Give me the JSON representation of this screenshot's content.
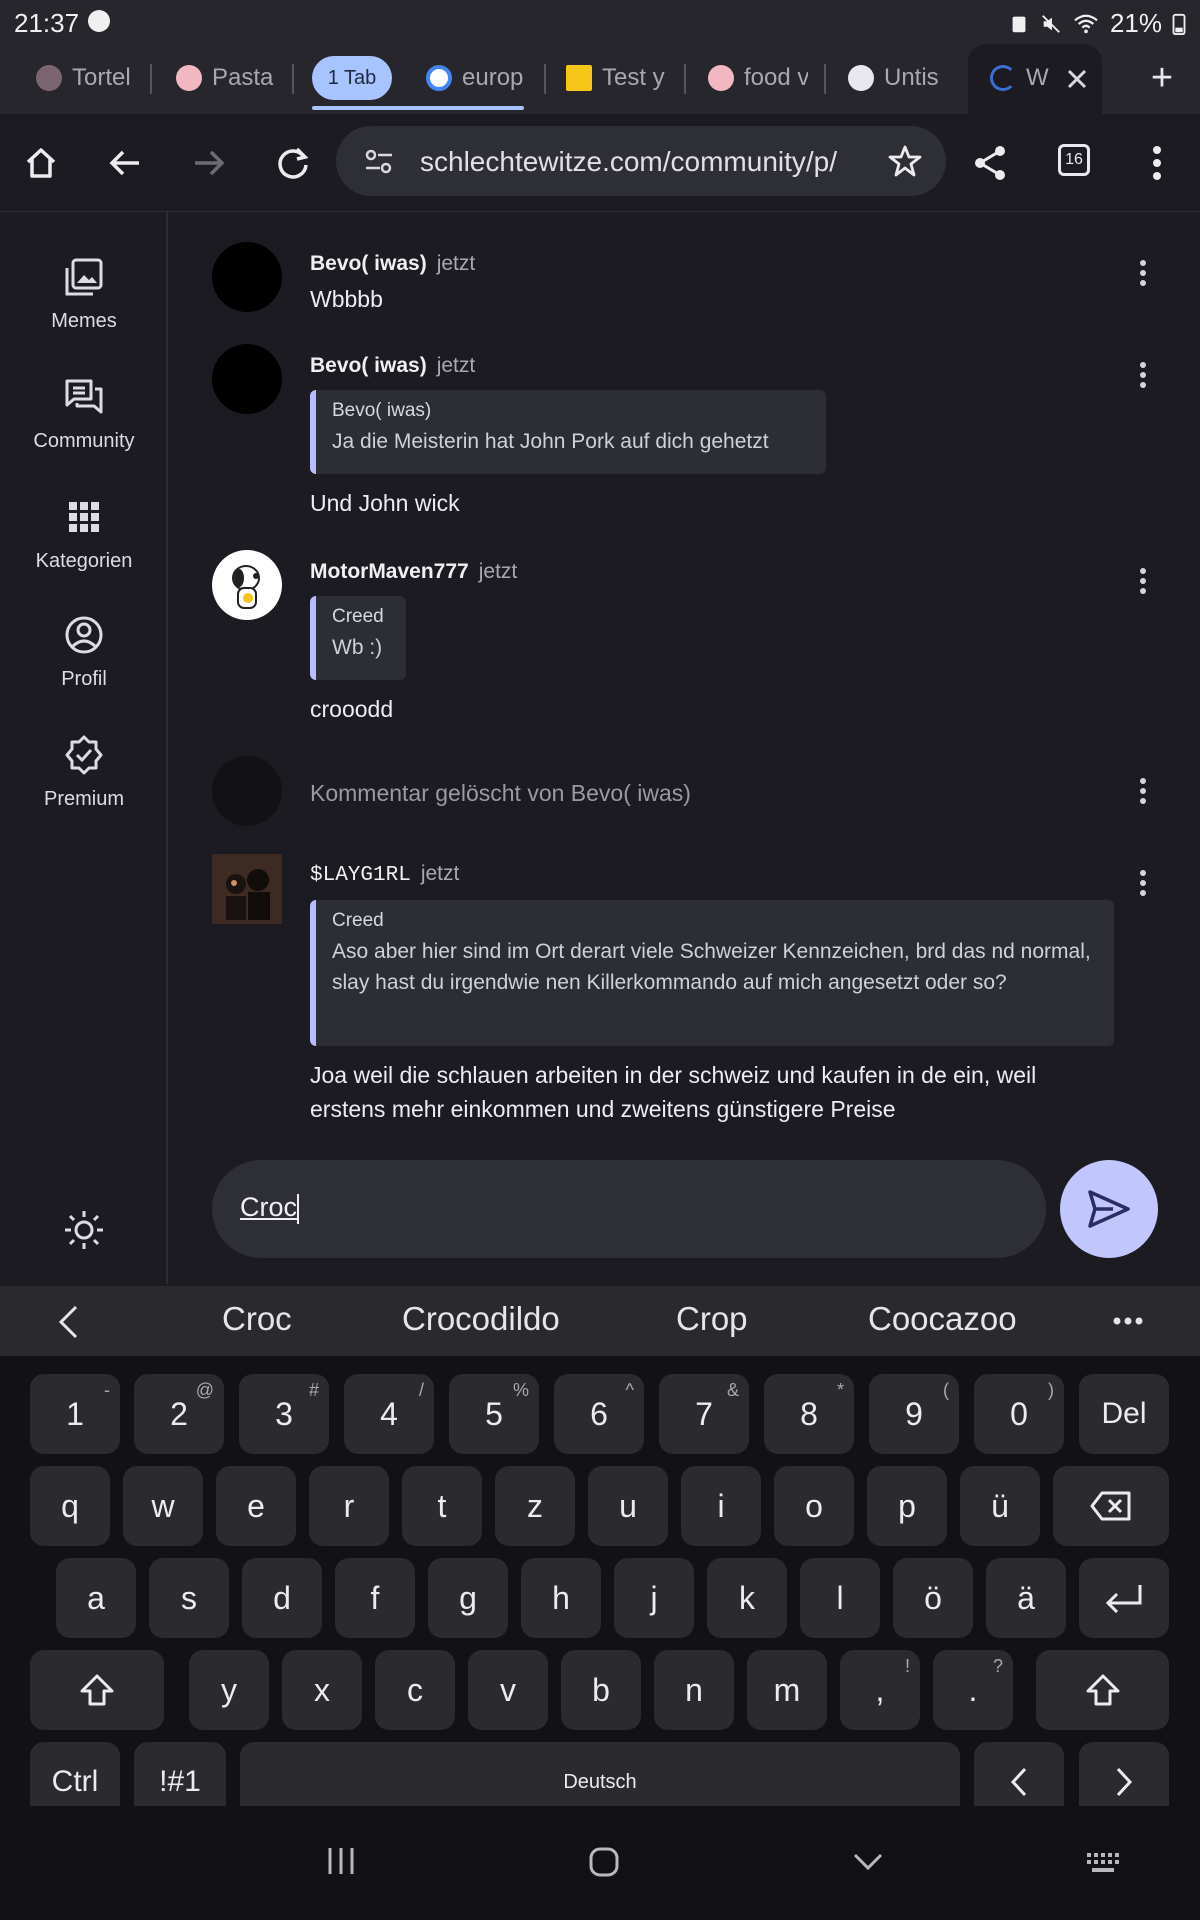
{
  "status": {
    "time": "21:37",
    "battery": "21%"
  },
  "tabs": [
    {
      "title": "Tortel",
      "fav_color": "#7b6670"
    },
    {
      "title": "Pasta",
      "fav_color": "#f2b8c2"
    },
    {
      "title": "europ",
      "fav_color": "#ffffff"
    },
    {
      "title": "Test y",
      "fav_color": "#f5c518"
    },
    {
      "title": "food v",
      "fav_color": "#f2b8c2"
    },
    {
      "title": "Untis",
      "fav_color": "#e8e8ee"
    },
    {
      "title": "Wi",
      "fav_color": "#3b6fd6"
    }
  ],
  "tab_group_label": "1 Tab",
  "new_tab_label": "+",
  "toolbar": {
    "url": "schlechtewitze.com/community/p/",
    "tab_count": "16"
  },
  "sidebar": {
    "items": [
      {
        "label": "Memes",
        "icon": "memes-icon"
      },
      {
        "label": "Community",
        "icon": "community-icon"
      },
      {
        "label": "Kategorien",
        "icon": "grid-icon"
      },
      {
        "label": "Profil",
        "icon": "profile-icon"
      },
      {
        "label": "Premium",
        "icon": "premium-badge-icon"
      }
    ]
  },
  "messages": [
    {
      "author": "Bevo( iwas)",
      "time": "jetzt",
      "text": "Wbbbb"
    },
    {
      "author": "Bevo( iwas)",
      "time": "jetzt",
      "quote_author": "Bevo( iwas)",
      "quote_text": "Ja die Meisterin hat John Pork auf dich gehetzt",
      "text": "Und John wick"
    },
    {
      "author": "MotorMaven777",
      "time": "jetzt",
      "quote_author": "Creed",
      "quote_text": "Wb :)",
      "text": "crooodd"
    },
    {
      "deleted_text": "Kommentar gelöscht von Bevo( iwas)"
    },
    {
      "author": "$LAYG1RL",
      "time": "jetzt",
      "quote_author": "Creed",
      "quote_text": "Aso aber hier sind im Ort derart viele Schweizer Kennzeichen, brd das nd normal, slay hast du irgendwie nen Killerkommando auf mich angesetzt oder so?",
      "text": "Joa weil die schlauen arbeiten in der schweiz und kaufen in de ein, weil erstens mehr einkommen und zweitens günstigere Preise"
    }
  ],
  "composer": {
    "value": "Croc"
  },
  "suggestions": [
    "Croc",
    "Crocodildo",
    "Crop",
    "Coocazoo"
  ],
  "keyboard": {
    "row1": [
      [
        "1",
        "-"
      ],
      [
        "2",
        "@"
      ],
      [
        "3",
        "#"
      ],
      [
        "4",
        "/"
      ],
      [
        "5",
        "%"
      ],
      [
        "6",
        "^"
      ],
      [
        "7",
        "&"
      ],
      [
        "8",
        "*"
      ],
      [
        "9",
        "("
      ],
      [
        "0",
        ")"
      ]
    ],
    "del": "Del",
    "row2": [
      "q",
      "w",
      "e",
      "r",
      "t",
      "z",
      "u",
      "i",
      "o",
      "p",
      "ü"
    ],
    "row3": [
      "a",
      "s",
      "d",
      "f",
      "g",
      "h",
      "j",
      "k",
      "l",
      "ö",
      "ä"
    ],
    "row4": [
      "y",
      "x",
      "c",
      "v",
      "b",
      "n",
      "m"
    ],
    "comma": [
      ",",
      "!"
    ],
    "period": [
      ".",
      "?"
    ],
    "ctrl": "Ctrl",
    "symbols": "!#1",
    "space": "Deutsch"
  },
  "colors": {
    "accent": "#a8c4ff",
    "send_button": "#c2c6ff",
    "quote_bar": "#b8bcff"
  }
}
